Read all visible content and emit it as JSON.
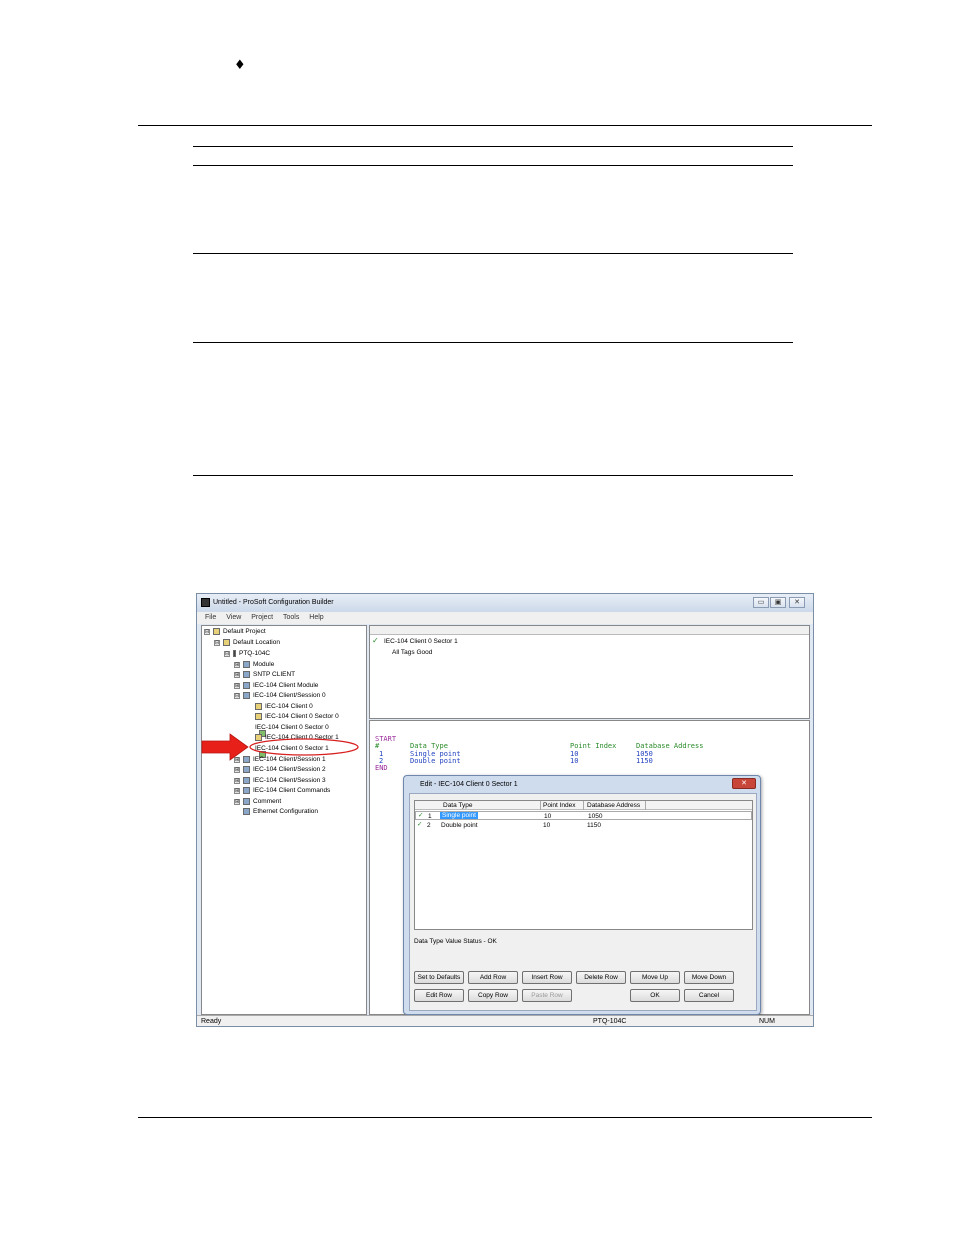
{
  "page": {
    "bullet": "♦"
  },
  "window": {
    "title": "Untitled - ProSoft Configuration Builder",
    "buttons": {
      "minimize": "▭",
      "maximize": "▣",
      "close": "✕"
    },
    "menu": [
      "File",
      "View",
      "Project",
      "Tools",
      "Help"
    ],
    "tree": [
      {
        "label": "Default Project",
        "expander": "⊟",
        "icon": "folder"
      },
      {
        "label": "Default Location",
        "expander": "⊟",
        "icon": "folder"
      },
      {
        "label": "PTQ-104C",
        "expander": "⊟",
        "icon": "device"
      },
      {
        "label": "Module",
        "expander": "⊞",
        "icon": "network"
      },
      {
        "label": "SNTP CLIENT",
        "expander": "⊞",
        "icon": "network"
      },
      {
        "label": "IEC-104 Client Module",
        "expander": "⊞",
        "icon": "network"
      },
      {
        "label": "IEC-104 Client/Session 0",
        "expander": "⊟",
        "icon": "network"
      },
      {
        "label": "IEC-104 Client 0",
        "expander": "",
        "icon": "doc"
      },
      {
        "label": "IEC-104 Client 0 Sector 0",
        "expander": "",
        "icon": "doc"
      },
      {
        "label": "IEC-104 Client 0 Sector 0",
        "expander": "",
        "icon": "grid"
      },
      {
        "label": "IEC-104 Client 0 Sector 1",
        "expander": "",
        "icon": "doc"
      },
      {
        "label": "IEC-104 Client 0 Sector 1",
        "expander": "",
        "icon": "grid"
      },
      {
        "label": "IEC-104 Client/Session 1",
        "expander": "⊞",
        "icon": "network"
      },
      {
        "label": "IEC-104 Client/Session 2",
        "expander": "⊞",
        "icon": "network"
      },
      {
        "label": "IEC-104 Client/Session 3",
        "expander": "⊞",
        "icon": "network"
      },
      {
        "label": "IEC-104 Client Commands",
        "expander": "⊞",
        "icon": "network"
      },
      {
        "label": "Comment",
        "expander": "⊞",
        "icon": "network"
      },
      {
        "label": "Ethernet Configuration",
        "expander": "",
        "icon": "network"
      }
    ],
    "top_pane": {
      "check": "✓",
      "title": "IEC-104 Client 0 Sector 1",
      "subtitle": "All Tags Good"
    },
    "code": {
      "start": "START",
      "header_hash": "#",
      "header_type": "Data Type",
      "header_point": "Point Index",
      "header_db": "Database Address",
      "rows": [
        {
          "num": "1",
          "type": "Single point",
          "point": "10",
          "db": "1050"
        },
        {
          "num": "2",
          "type": "Double point",
          "point": "10",
          "db": "1150"
        }
      ],
      "end": "END"
    },
    "status": {
      "left": "Ready",
      "center": "PTQ-104C",
      "right": "NUM"
    }
  },
  "dialog": {
    "title": "Edit - IEC-104 Client 0 Sector 1",
    "close": "✕",
    "columns": [
      "Data Type",
      "Point Index",
      "Database Address"
    ],
    "rows": [
      {
        "check": "✓",
        "num": "1",
        "type": "Single point",
        "point": "10",
        "db": "1050"
      },
      {
        "check": "✓",
        "num": "2",
        "type": "Double point",
        "point": "10",
        "db": "1150"
      }
    ],
    "status_text": "Data Type Value Status - OK",
    "buttons_row1": [
      "Set to Defaults",
      "Add Row",
      "Insert Row",
      "Delete Row",
      "Move Up",
      "Move Down"
    ],
    "buttons_row2": [
      "Edit Row",
      "Copy Row",
      "Paste Row",
      "OK",
      "Cancel"
    ]
  },
  "colors": {
    "keyword": "#9b2a9b",
    "header": "#2a8a2a",
    "value": "#1f3fbf",
    "arrow": "#e8201a",
    "highlight": "#d81e1e"
  }
}
